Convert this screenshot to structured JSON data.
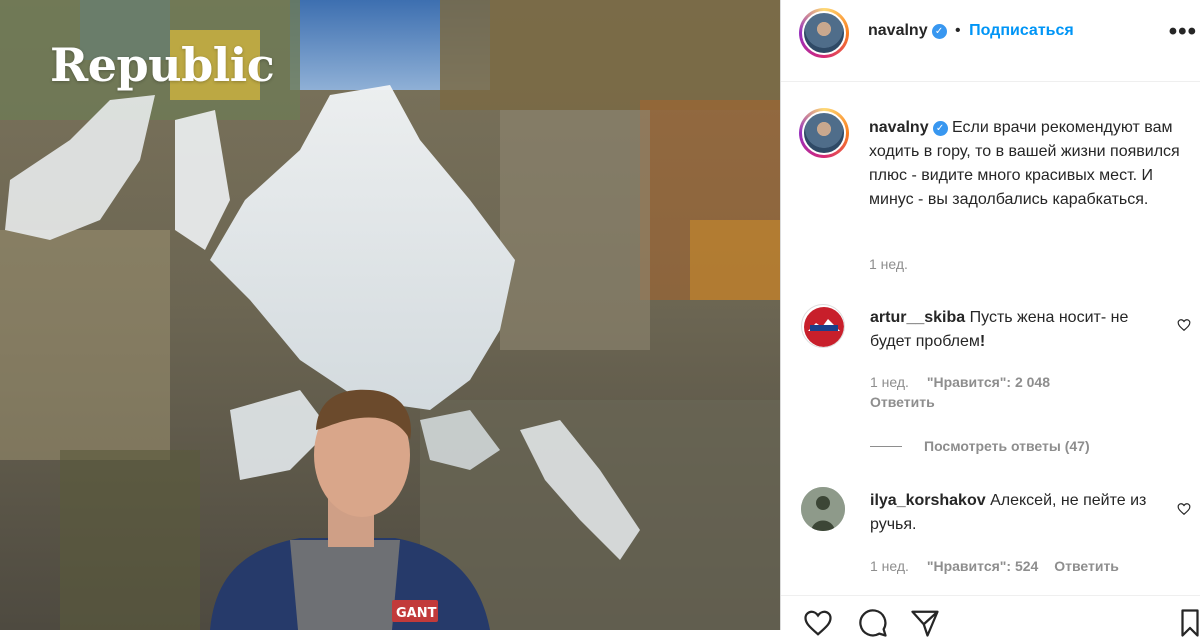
{
  "brand": "Republic",
  "post": {
    "username": "navalny",
    "follow_label": "Подписаться",
    "separator": "•",
    "more_label": "•••",
    "caption": "Если врачи рекомендуют вам ходить в гору, то в вашей жизни появился плюс - видите много красивых мест. И минус - вы задолбались карабкаться.",
    "caption_time": "1 нед."
  },
  "comments": [
    {
      "username": "artur__skiba",
      "text": "Пусть жена носит- не будет проблем",
      "emphasis": "!",
      "time": "1 нед.",
      "likes": "\"Нравится\": 2 048",
      "reply": "Ответить",
      "view_replies": "Посмотреть ответы (47)"
    },
    {
      "username": "ilya_korshakov",
      "text": "Алексей, не пейте из ручья.",
      "time": "1 нед.",
      "likes": "\"Нравится\": 524",
      "reply": "Ответить"
    }
  ],
  "colors": {
    "link": "#0095f6",
    "verified": "#3897f0",
    "text": "#262626",
    "muted": "#8e8e8e"
  },
  "icons": [
    "heart-icon",
    "comment-icon",
    "share-icon",
    "verified-badge-icon",
    "more-options-icon"
  ]
}
